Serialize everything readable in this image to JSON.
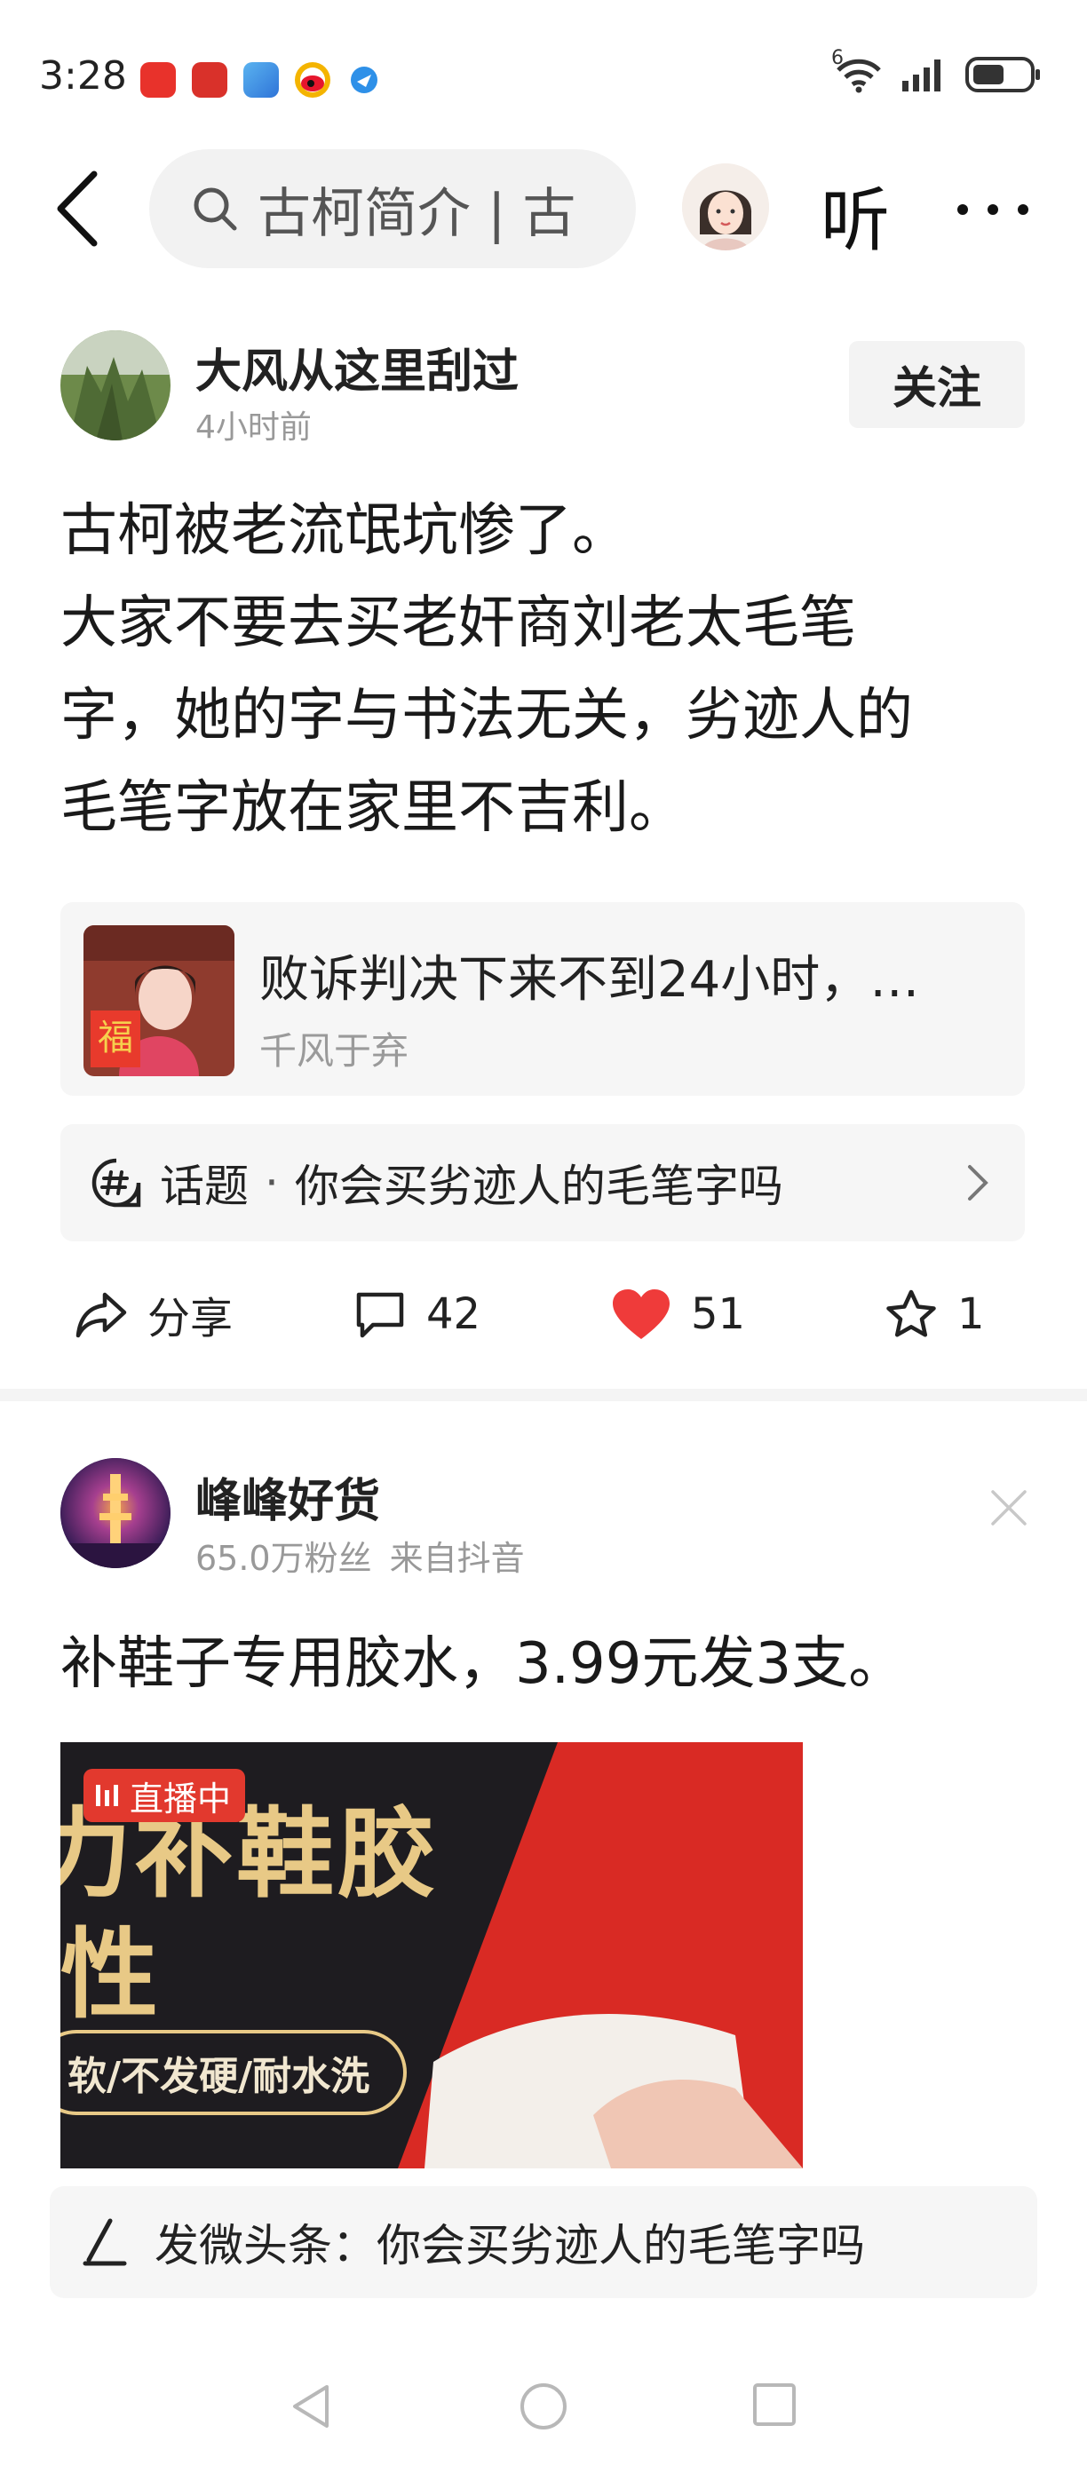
{
  "status_bar": {
    "time": "3:28",
    "network": "6",
    "app_icons": [
      "video-app-icon",
      "huawei-store-icon",
      "weather-app-icon",
      "weibo-icon",
      "browser-icon"
    ]
  },
  "nav": {
    "search_text": "古柯简介 | 古",
    "listen_label": "听"
  },
  "post1": {
    "author": "大风从这里刮过",
    "time": "4小时前",
    "follow_label": "关注",
    "body_lines": [
      "古柯被老流氓坑惨了。",
      "大家不要去买老奸商刘老太毛笔",
      "字，她的字与书法无关，劣迹人的",
      "毛笔字放在家里不吉利。"
    ],
    "ref_card": {
      "title": "败诉判决下来不到24小时，…",
      "source": "千风于弃",
      "thumb_char": "福"
    },
    "topic": {
      "label": "话题",
      "dot": "·",
      "text": "你会买劣迹人的毛笔字吗"
    },
    "actions": {
      "share_label": "分享",
      "comments": "42",
      "likes": "51",
      "favorites": "1"
    }
  },
  "post2": {
    "author": "峰峰好货",
    "followers": "65.0万粉丝",
    "source": "来自抖音",
    "body": "补鞋子专用胶水，3.99元发3支。",
    "promo": {
      "live_badge": "直播中",
      "headline": "力补鞋胶",
      "headline2": "性",
      "pill_text": "软/不发硬/耐水洗"
    }
  },
  "compose": {
    "label": "发微头条：",
    "text": "你会买劣迹人的毛笔字吗"
  },
  "colors": {
    "accent_red": "#e2392e",
    "like_red": "#ef3b3a",
    "gold": "#e8c986"
  }
}
